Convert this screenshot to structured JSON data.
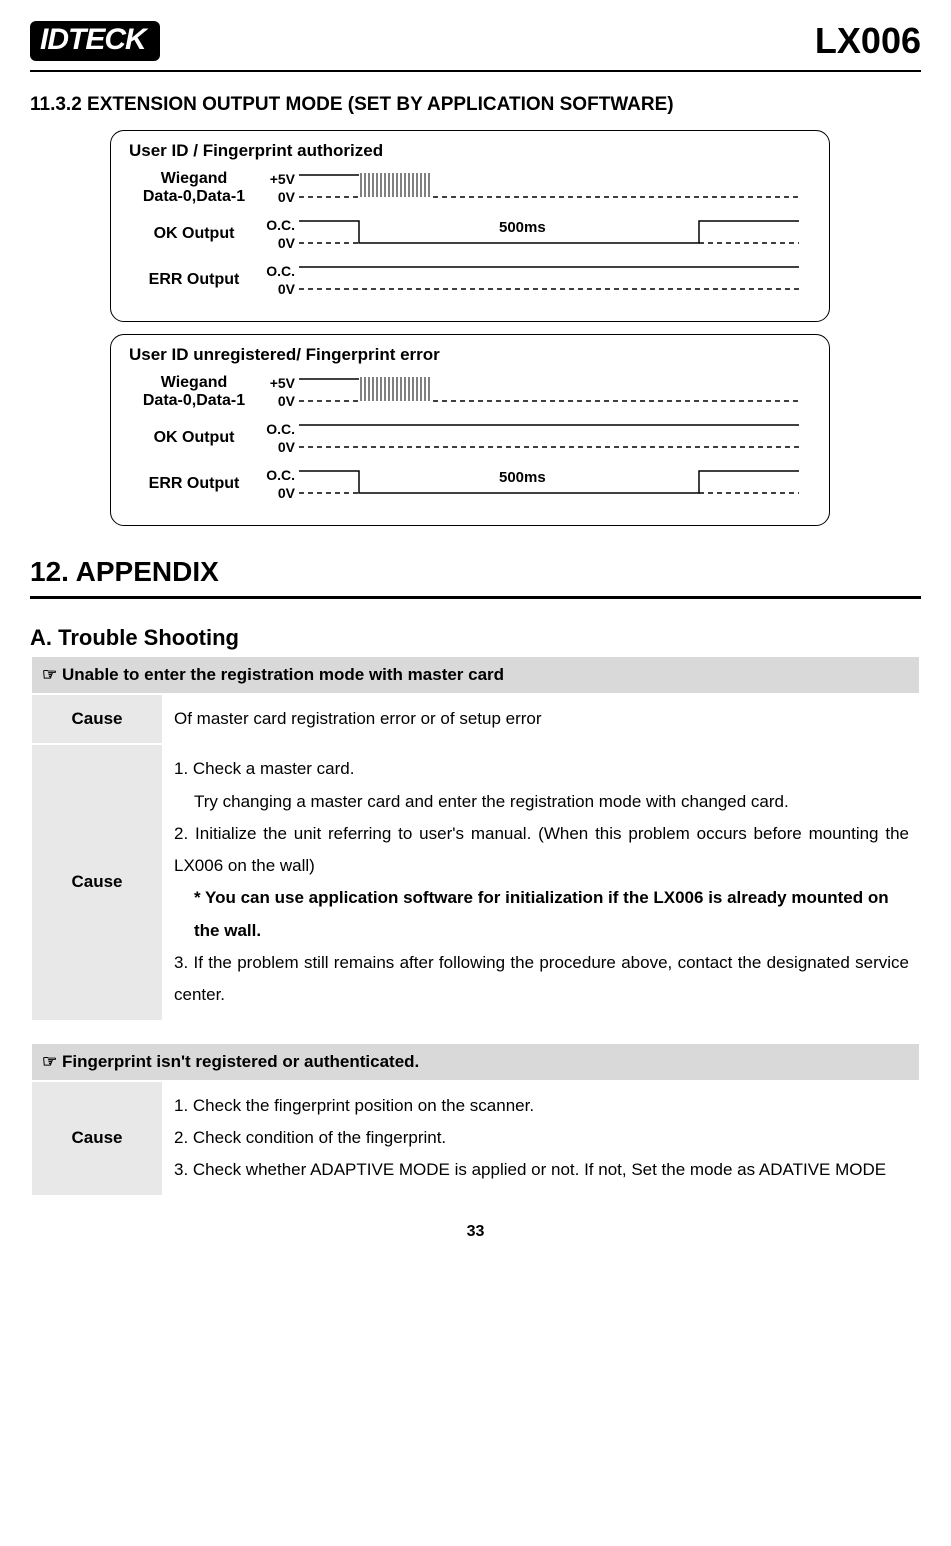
{
  "header": {
    "logo_text": "IDTECK",
    "product": "LX006"
  },
  "section_1132": {
    "heading": "11.3.2 EXTENSION OUTPUT MODE (SET BY APPLICATION SOFTWARE)"
  },
  "chart_data": [
    {
      "type": "timing-diagram",
      "title": "User ID / Fingerprint authorized",
      "signals": [
        {
          "name": "Wiegand\nData-0,Data-1",
          "high_label": "+5V",
          "low_label": "0V",
          "pattern": "burst"
        },
        {
          "name": "OK Output",
          "high_label": "O.C.",
          "low_label": "0V",
          "pattern": "pulse-low",
          "duration_label": "500ms"
        },
        {
          "name": "ERR Output",
          "high_label": "O.C.",
          "low_label": "0V",
          "pattern": "flat-high"
        }
      ]
    },
    {
      "type": "timing-diagram",
      "title": "User ID unregistered/ Fingerprint error",
      "signals": [
        {
          "name": "Wiegand\nData-0,Data-1",
          "high_label": "+5V",
          "low_label": "0V",
          "pattern": "burst"
        },
        {
          "name": "OK Output",
          "high_label": "O.C.",
          "low_label": "0V",
          "pattern": "flat-high"
        },
        {
          "name": "ERR Output",
          "high_label": "O.C.",
          "low_label": "0V",
          "pattern": "pulse-low",
          "duration_label": "500ms"
        }
      ]
    }
  ],
  "appendix": {
    "heading": "12. APPENDIX",
    "sub_a": "A. Trouble Shooting"
  },
  "trouble": [
    {
      "title": "☞  Unable to enter the registration mode with master card",
      "rows": [
        {
          "label": "Cause",
          "body_lines": [
            "Of master card registration error or of setup error"
          ]
        },
        {
          "label": "Cause",
          "body_lines": [
            "1. Check a master card.",
            "   Try changing a master card and enter the registration mode with changed card.",
            "2. Initialize the unit referring to user's manual. (When this problem occurs before mounting the LX006 on the wall)",
            "*NOTE* * You can use application software for initialization if the LX006 is already mounted on the wall.",
            "3. If the problem still remains after following the procedure above, contact the designated service center."
          ]
        }
      ]
    },
    {
      "title": "☞ Fingerprint isn't registered or authenticated.",
      "rows": [
        {
          "label": "Cause",
          "body_lines": [
            "1. Check the fingerprint position on the scanner.",
            "2. Check condition of the fingerprint.",
            "3. Check whether ADAPTIVE MODE is applied or not. If not, Set the mode as ADATIVE MODE"
          ]
        }
      ]
    }
  ],
  "page_number": "33"
}
